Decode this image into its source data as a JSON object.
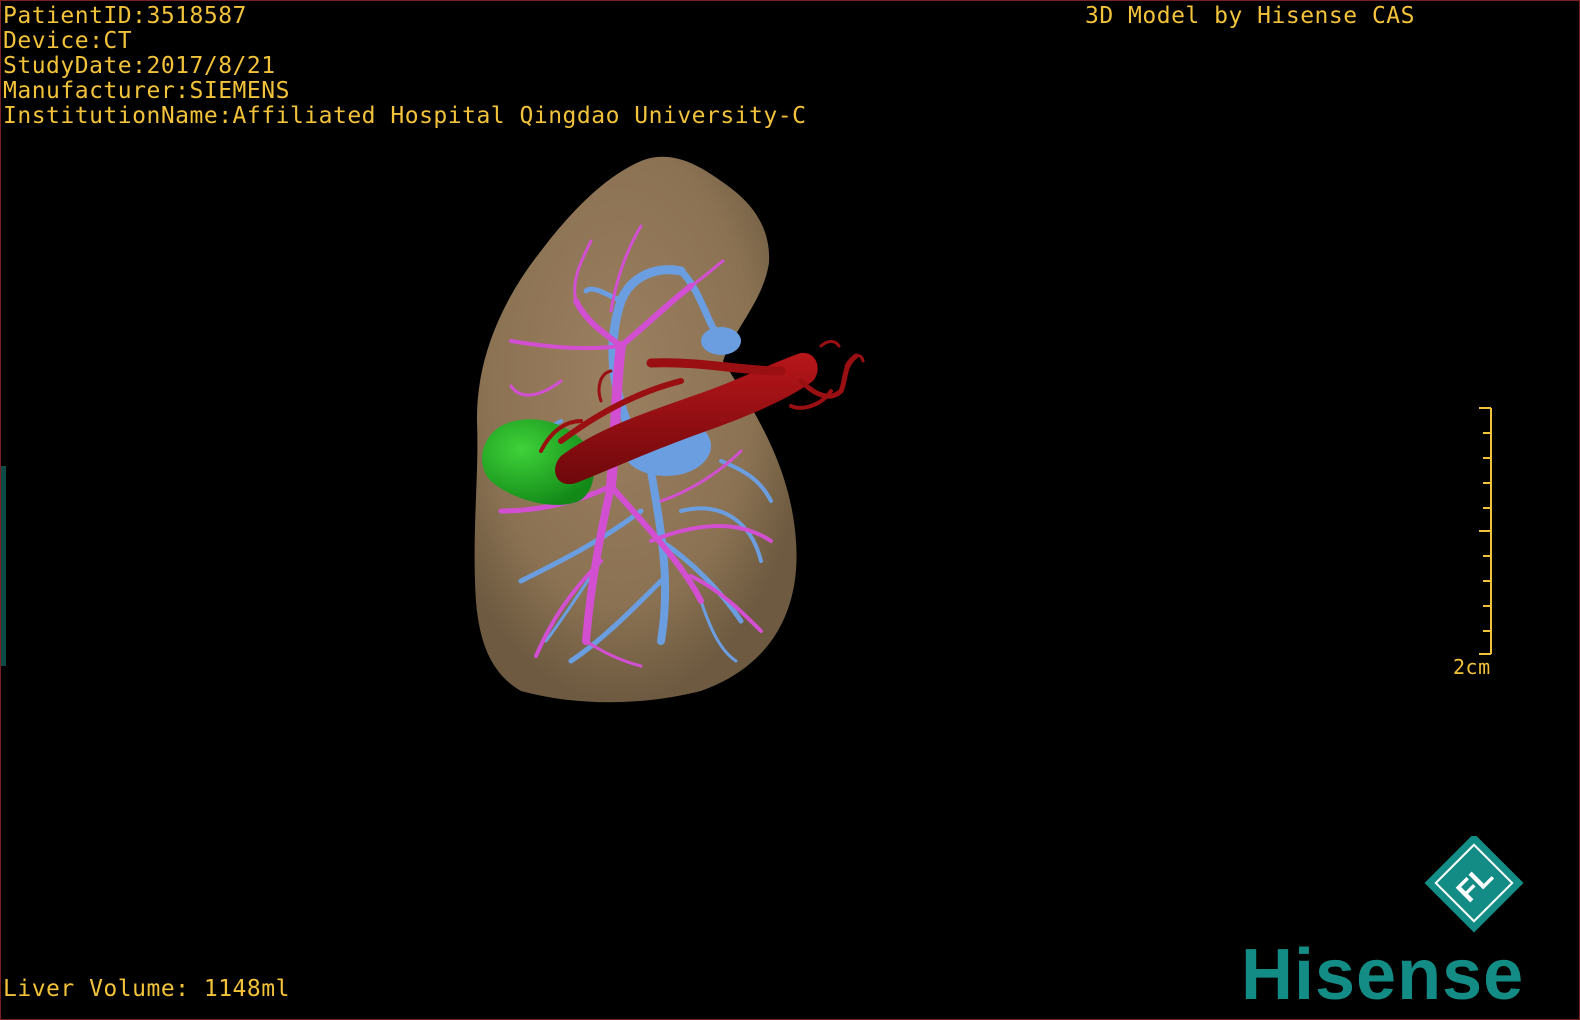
{
  "overlay": {
    "patient_id": "PatientID:3518587",
    "device": "Device:CT",
    "study_date": "StudyDate:2017/8/21",
    "manufacturer": "Manufacturer:SIEMENS",
    "institution": "InstitutionName:Affiliated Hospital Qingdao University-C",
    "brand_title": "3D Model by Hisense CAS",
    "liver_volume": "Liver Volume: 1148ml"
  },
  "scale_bar": {
    "label": "2cm"
  },
  "logo": {
    "wordmark": "Hisense",
    "badge_letters": "FL"
  },
  "colors": {
    "overlay_text": "#f2c23a",
    "liver": "#8b7253",
    "portal_vein": "#d24fd2",
    "hepatic_vein": "#6b9ee0",
    "artery_ivc": "#9a0f12",
    "gallbladder": "#1fa524",
    "logo_teal": "#148c86",
    "frame_border": "#7a1f24"
  }
}
